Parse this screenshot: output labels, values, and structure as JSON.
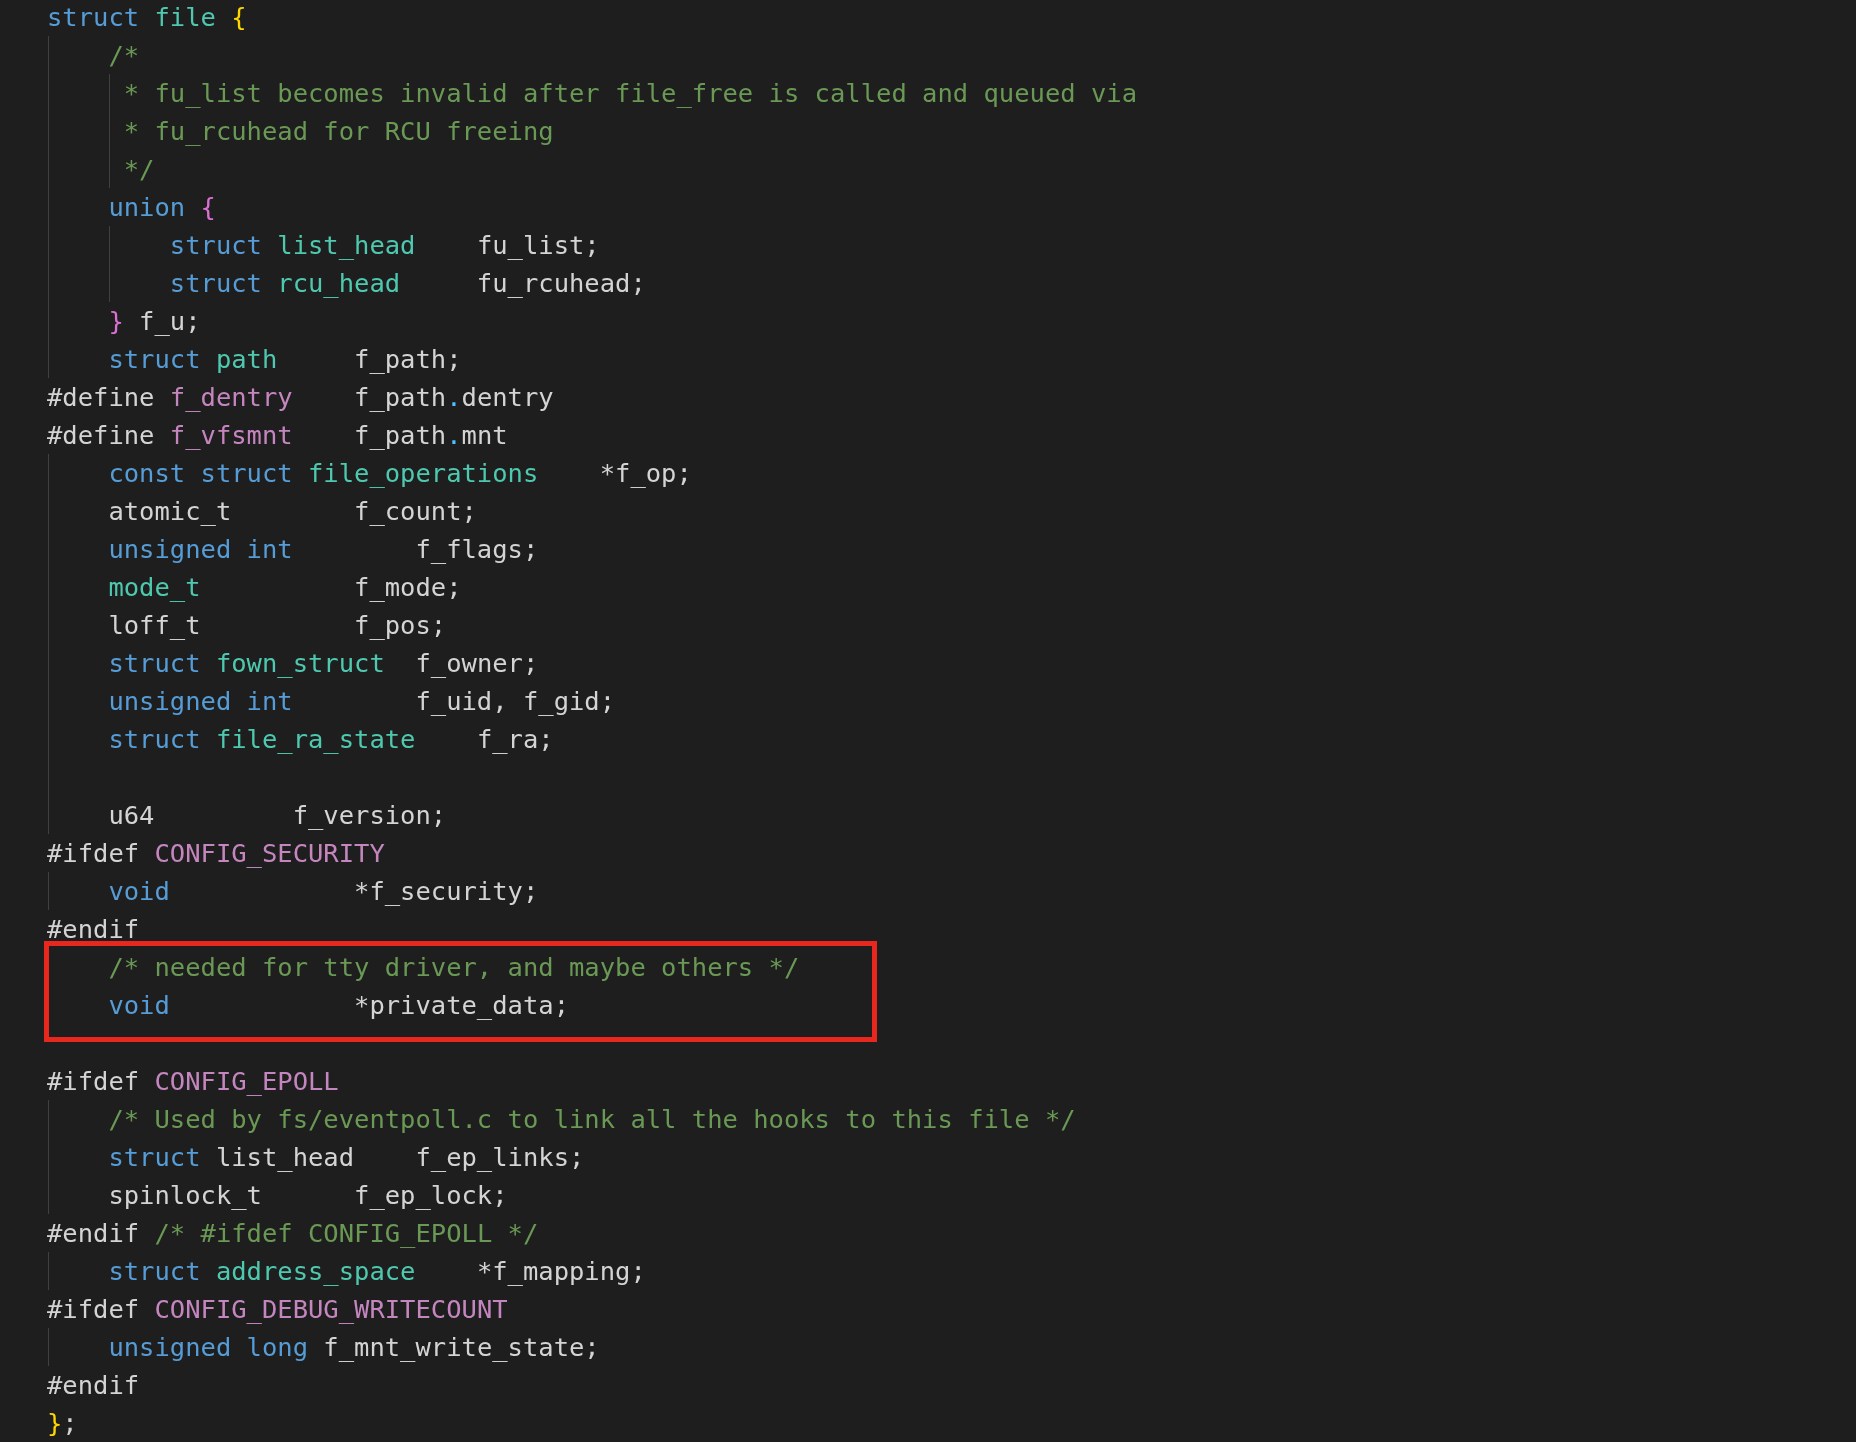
{
  "editor": {
    "lines": [
      {
        "kind": "code",
        "tokens": [
          {
            "text": "struct",
            "kind": "keyword"
          },
          {
            "text": " file",
            "kind": "type"
          },
          {
            "text": " {",
            "kind": "brace_outer"
          }
        ]
      },
      {
        "kind": "code",
        "tokens": [
          {
            "text": "    /*",
            "kind": "comment"
          }
        ]
      },
      {
        "kind": "code",
        "tokens": [
          {
            "text": "     * fu_list becomes invalid after file_free is called and queued via",
            "kind": "comment"
          }
        ]
      },
      {
        "kind": "code",
        "tokens": [
          {
            "text": "     * fu_rcuhead for RCU freeing",
            "kind": "comment"
          }
        ]
      },
      {
        "kind": "code",
        "tokens": [
          {
            "text": "     */",
            "kind": "comment"
          }
        ]
      },
      {
        "kind": "code",
        "tokens": [
          {
            "text": "    union",
            "kind": "keyword"
          },
          {
            "text": " {",
            "kind": "brace_inner"
          }
        ]
      },
      {
        "kind": "code",
        "tokens": [
          {
            "text": "        struct",
            "kind": "keyword"
          },
          {
            "text": " list_head",
            "kind": "type"
          },
          {
            "text": "    fu_list;",
            "kind": "plain"
          }
        ]
      },
      {
        "kind": "code",
        "tokens": [
          {
            "text": "        struct",
            "kind": "keyword"
          },
          {
            "text": " rcu_head",
            "kind": "type"
          },
          {
            "text": "     fu_rcuhead;",
            "kind": "plain"
          }
        ]
      },
      {
        "kind": "code",
        "tokens": [
          {
            "text": "    }",
            "kind": "brace_inner"
          },
          {
            "text": " f_u;",
            "kind": "plain"
          }
        ]
      },
      {
        "kind": "code",
        "tokens": [
          {
            "text": "    struct",
            "kind": "keyword"
          },
          {
            "text": " path",
            "kind": "type"
          },
          {
            "text": "     f_path;",
            "kind": "plain"
          }
        ]
      },
      {
        "kind": "code",
        "tokens": [
          {
            "text": "#define",
            "kind": "plain"
          },
          {
            "text": " f_dentry",
            "kind": "macro"
          },
          {
            "text": "    f_path",
            "kind": "plain"
          },
          {
            "text": ".",
            "kind": "punct"
          },
          {
            "text": "dentry",
            "kind": "plain"
          }
        ]
      },
      {
        "kind": "code",
        "tokens": [
          {
            "text": "#define",
            "kind": "plain"
          },
          {
            "text": " f_vfsmnt",
            "kind": "macro"
          },
          {
            "text": "    f_path",
            "kind": "plain"
          },
          {
            "text": ".",
            "kind": "punct"
          },
          {
            "text": "mnt",
            "kind": "plain"
          }
        ]
      },
      {
        "kind": "code",
        "tokens": [
          {
            "text": "    const struct",
            "kind": "keyword"
          },
          {
            "text": " file_operations",
            "kind": "type"
          },
          {
            "text": "    *f_op;",
            "kind": "plain"
          }
        ]
      },
      {
        "kind": "code",
        "tokens": [
          {
            "text": "    atomic_t        f_count;",
            "kind": "plain"
          }
        ]
      },
      {
        "kind": "code",
        "tokens": [
          {
            "text": "    unsigned int",
            "kind": "keyword"
          },
          {
            "text": "        f_flags;",
            "kind": "plain"
          }
        ]
      },
      {
        "kind": "code",
        "tokens": [
          {
            "text": "    mode_t",
            "kind": "type"
          },
          {
            "text": "          f_mode;",
            "kind": "plain"
          }
        ]
      },
      {
        "kind": "code",
        "tokens": [
          {
            "text": "    loff_t          f_pos;",
            "kind": "plain"
          }
        ]
      },
      {
        "kind": "code",
        "tokens": [
          {
            "text": "    struct",
            "kind": "keyword"
          },
          {
            "text": " fown_struct",
            "kind": "type"
          },
          {
            "text": "  f_owner;",
            "kind": "plain"
          }
        ]
      },
      {
        "kind": "code",
        "tokens": [
          {
            "text": "    unsigned int",
            "kind": "keyword"
          },
          {
            "text": "        f_uid, f_gid;",
            "kind": "plain"
          }
        ]
      },
      {
        "kind": "code",
        "tokens": [
          {
            "text": "    struct",
            "kind": "keyword"
          },
          {
            "text": " file_ra_state",
            "kind": "type"
          },
          {
            "text": "    f_ra;",
            "kind": "plain"
          }
        ]
      },
      {
        "kind": "blank",
        "guide": true
      },
      {
        "kind": "code",
        "tokens": [
          {
            "text": "    u64         f_version;",
            "kind": "plain"
          }
        ]
      },
      {
        "kind": "code",
        "tokens": [
          {
            "text": "#ifdef",
            "kind": "plain"
          },
          {
            "text": " CONFIG_SECURITY",
            "kind": "macro"
          }
        ]
      },
      {
        "kind": "code",
        "tokens": [
          {
            "text": "    void",
            "kind": "keyword"
          },
          {
            "text": "            *f_security;",
            "kind": "plain"
          }
        ]
      },
      {
        "kind": "code",
        "tokens": [
          {
            "text": "#endif",
            "kind": "plain"
          }
        ]
      },
      {
        "kind": "highlight",
        "lines": [
          {
            "kind": "code",
            "tokens": [
              {
                "text": "    /* needed for tty driver, and maybe others */",
                "kind": "comment"
              }
            ]
          },
          {
            "kind": "code",
            "tokens": [
              {
                "text": "    void",
                "kind": "keyword"
              },
              {
                "text": "            *private_data;",
                "kind": "plain"
              }
            ]
          }
        ]
      },
      {
        "kind": "blank",
        "guide": false
      },
      {
        "kind": "code",
        "tokens": [
          {
            "text": "#ifdef",
            "kind": "plain"
          },
          {
            "text": " CONFIG_EPOLL",
            "kind": "macro"
          }
        ]
      },
      {
        "kind": "code",
        "tokens": [
          {
            "text": "    /* Used by fs/eventpoll.c to link all the hooks to this file */",
            "kind": "comment"
          }
        ]
      },
      {
        "kind": "code",
        "tokens": [
          {
            "text": "    struct",
            "kind": "keyword"
          },
          {
            "text": " list_head    f_ep_links;",
            "kind": "plain"
          }
        ]
      },
      {
        "kind": "code",
        "tokens": [
          {
            "text": "    spinlock_t      f_ep_lock;",
            "kind": "plain"
          }
        ]
      },
      {
        "kind": "code",
        "tokens": [
          {
            "text": "#endif",
            "kind": "plain"
          },
          {
            "text": " /* #ifdef CONFIG_EPOLL */",
            "kind": "comment"
          }
        ]
      },
      {
        "kind": "code",
        "tokens": [
          {
            "text": "    struct",
            "kind": "keyword"
          },
          {
            "text": " address_space",
            "kind": "type"
          },
          {
            "text": "    *f_mapping;",
            "kind": "plain"
          }
        ]
      },
      {
        "kind": "code",
        "tokens": [
          {
            "text": "#ifdef",
            "kind": "plain"
          },
          {
            "text": " CONFIG_DEBUG_WRITECOUNT",
            "kind": "macro"
          }
        ]
      },
      {
        "kind": "code",
        "tokens": [
          {
            "text": "    unsigned long",
            "kind": "keyword"
          },
          {
            "text": " f_mnt_write_state;",
            "kind": "plain"
          }
        ]
      },
      {
        "kind": "code",
        "tokens": [
          {
            "text": "#endif",
            "kind": "plain"
          }
        ]
      },
      {
        "kind": "code",
        "tokens": [
          {
            "text": "}",
            "kind": "brace_outer"
          },
          {
            "text": ";",
            "kind": "plain"
          }
        ]
      }
    ]
  }
}
